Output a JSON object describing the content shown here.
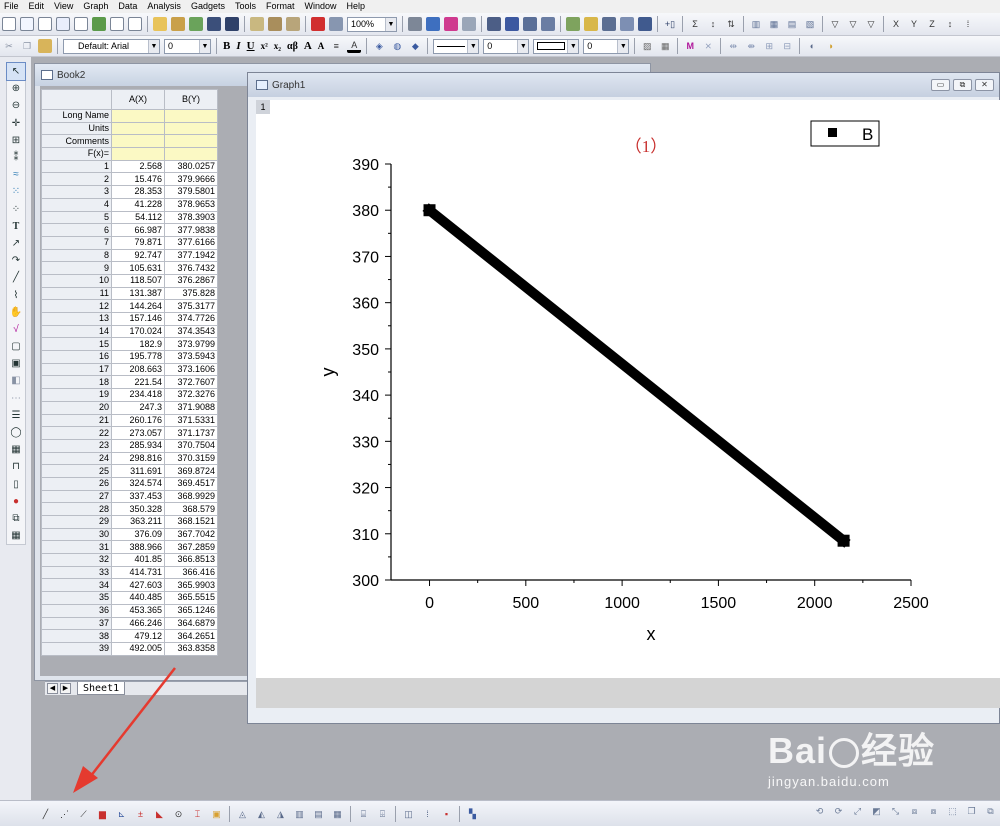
{
  "menu": [
    "File",
    "Edit",
    "View",
    "Graph",
    "Data",
    "Analysis",
    "Gadgets",
    "Tools",
    "Format",
    "Window",
    "Help"
  ],
  "toolbar": {
    "zoom": "100%",
    "font": "Default: Arial",
    "font_size": "0",
    "bold": "B",
    "italic": "I",
    "underline": "U",
    "superscript": "x²",
    "subscript": "x₂",
    "greek": "αβ",
    "font_grow": "A",
    "font_shrink": "A",
    "line_width": "0",
    "border_width": "0"
  },
  "book": {
    "title": "Book2",
    "columns": [
      "A(X)",
      "B(Y)"
    ],
    "meta_labels": [
      "Long Name",
      "Units",
      "Comments",
      "F(x)="
    ],
    "rows": [
      [
        "1",
        "2.568",
        "380.0257"
      ],
      [
        "2",
        "15.476",
        "379.9666"
      ],
      [
        "3",
        "28.353",
        "379.5801"
      ],
      [
        "4",
        "41.228",
        "378.9653"
      ],
      [
        "5",
        "54.112",
        "378.3903"
      ],
      [
        "6",
        "66.987",
        "377.9838"
      ],
      [
        "7",
        "79.871",
        "377.6166"
      ],
      [
        "8",
        "92.747",
        "377.1942"
      ],
      [
        "9",
        "105.631",
        "376.7432"
      ],
      [
        "10",
        "118.507",
        "376.2867"
      ],
      [
        "11",
        "131.387",
        "375.828"
      ],
      [
        "12",
        "144.264",
        "375.3177"
      ],
      [
        "13",
        "157.146",
        "374.7726"
      ],
      [
        "14",
        "170.024",
        "374.3543"
      ],
      [
        "15",
        "182.9",
        "373.9799"
      ],
      [
        "16",
        "195.778",
        "373.5943"
      ],
      [
        "17",
        "208.663",
        "373.1606"
      ],
      [
        "18",
        "221.54",
        "372.7607"
      ],
      [
        "19",
        "234.418",
        "372.3276"
      ],
      [
        "20",
        "247.3",
        "371.9088"
      ],
      [
        "21",
        "260.176",
        "371.5331"
      ],
      [
        "22",
        "273.057",
        "371.1737"
      ],
      [
        "23",
        "285.934",
        "370.7504"
      ],
      [
        "24",
        "298.816",
        "370.3159"
      ],
      [
        "25",
        "311.691",
        "369.8724"
      ],
      [
        "26",
        "324.574",
        "369.4517"
      ],
      [
        "27",
        "337.453",
        "368.9929"
      ],
      [
        "28",
        "350.328",
        "368.579"
      ],
      [
        "29",
        "363.211",
        "368.1521"
      ],
      [
        "30",
        "376.09",
        "367.7042"
      ],
      [
        "31",
        "388.966",
        "367.2859"
      ],
      [
        "32",
        "401.85",
        "366.8513"
      ],
      [
        "33",
        "414.731",
        "366.416"
      ],
      [
        "34",
        "427.603",
        "365.9903"
      ],
      [
        "35",
        "440.485",
        "365.5515"
      ],
      [
        "36",
        "453.365",
        "365.1246"
      ],
      [
        "37",
        "466.246",
        "364.6879"
      ],
      [
        "38",
        "479.12",
        "364.2651"
      ],
      [
        "39",
        "492.005",
        "363.8358"
      ]
    ],
    "sheet_tab": "Sheet1"
  },
  "graph": {
    "title": "Graph1",
    "layer": "1"
  },
  "chart_data": {
    "type": "line",
    "title": "（1）",
    "xlabel": "x",
    "ylabel": "y",
    "xlim": [
      -200,
      2500
    ],
    "ylim": [
      300,
      390
    ],
    "xticks": [
      0,
      500,
      1000,
      1500,
      2000,
      2500
    ],
    "yticks": [
      300,
      310,
      320,
      330,
      340,
      350,
      360,
      370,
      380,
      390
    ],
    "legend_position": "top-right",
    "series": [
      {
        "name": "B",
        "color": "#000000",
        "marker": "square",
        "x": [
          0,
          2150
        ],
        "y": [
          380,
          308.5
        ]
      }
    ]
  },
  "watermark": {
    "logo": "Bai du 经验",
    "url": "jingyan.baidu.com"
  },
  "annotation_color": "#e53a2f"
}
